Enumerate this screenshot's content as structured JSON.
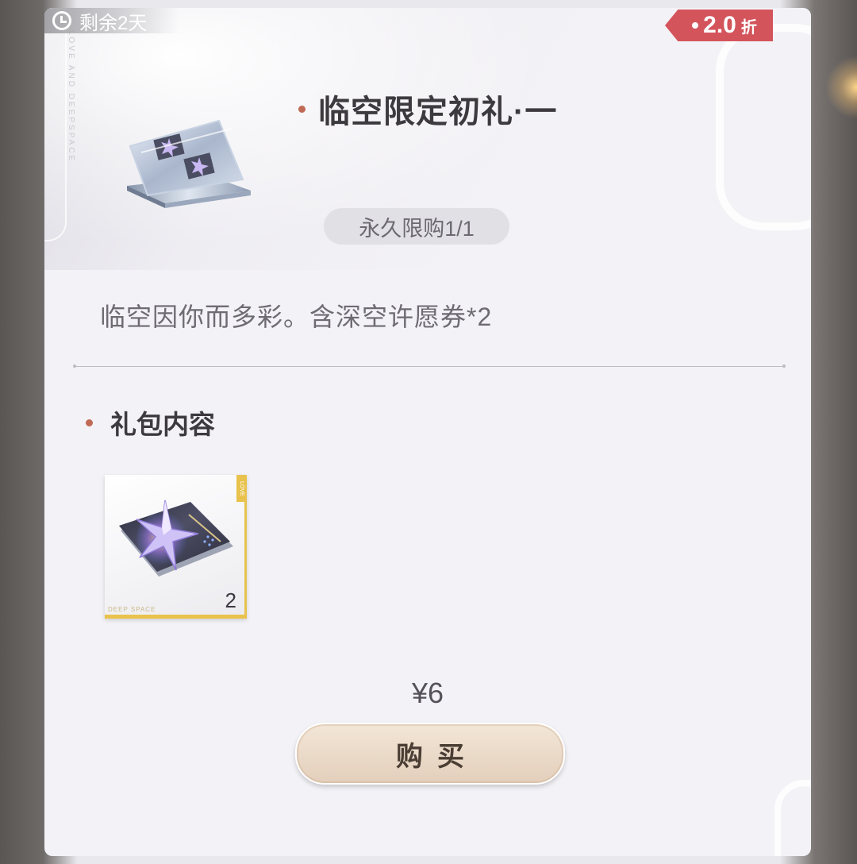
{
  "timer": {
    "text": "剩余2天",
    "icon": "clock-icon"
  },
  "discount": {
    "value": "2.0",
    "unit": "折"
  },
  "deco_text": "LOVE AND DEEPSPACE",
  "title": "临空限定初礼·一",
  "purchase_limit": "永久限购1/1",
  "description": "临空因你而多彩。含深空许愿券*2",
  "section_title": "礼包内容",
  "items": [
    {
      "name": "深空许愿券",
      "count": "2",
      "brand": "DEEP SPACE",
      "tag": "LOVE"
    }
  ],
  "price": "¥6",
  "buy_label": "购买",
  "colors": {
    "accent_dot": "#c06a56",
    "discount_bg": "#d4545c",
    "rarity_gold": "#e8c24c",
    "button_bg": "#ecdccb"
  }
}
